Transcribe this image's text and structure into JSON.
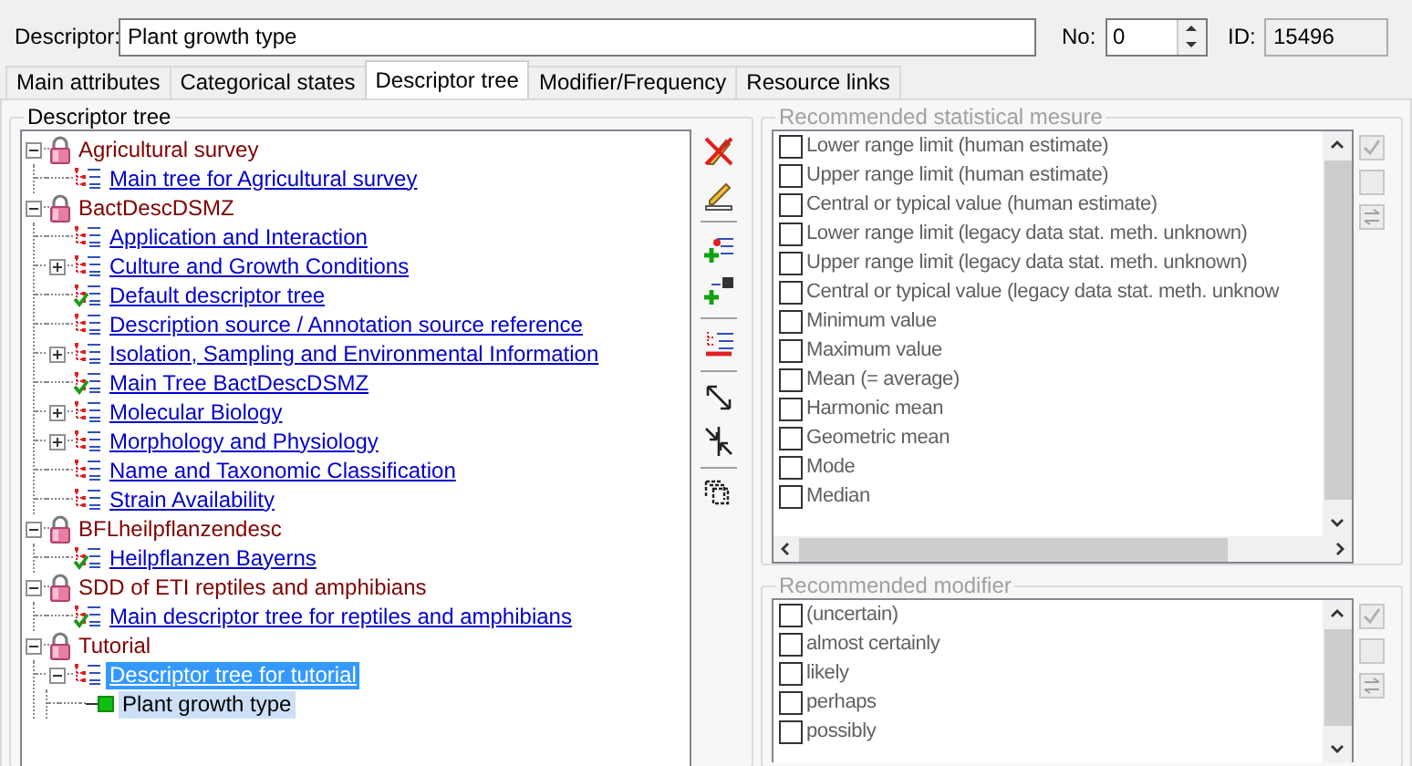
{
  "descriptor": {
    "label": "Descriptor:",
    "value": "Plant growth type"
  },
  "number": {
    "label": "No:",
    "value": "0"
  },
  "id": {
    "label": "ID:",
    "value": "15496",
    "disabled": true
  },
  "tabs": [
    {
      "label": "Main attributes",
      "selected": false
    },
    {
      "label": "Categorical states",
      "selected": false
    },
    {
      "label": "Descriptor tree",
      "selected": true
    },
    {
      "label": "Modifier/Frequency",
      "selected": false
    },
    {
      "label": "Resource links",
      "selected": false
    }
  ],
  "descriptor_tree": {
    "title": "Descriptor tree",
    "nodes": [
      {
        "label": "Agricultural survey",
        "kind": "project",
        "expanded": true,
        "selected": false,
        "children": [
          {
            "label": "Main tree for Agricultural survey",
            "kind": "tree",
            "default": false,
            "selected": false
          }
        ]
      },
      {
        "label": "BactDescDSMZ",
        "kind": "project",
        "expanded": true,
        "selected": false,
        "children": [
          {
            "label": "Application and Interaction",
            "kind": "tree",
            "default": false,
            "selected": false
          },
          {
            "label": "Culture and Growth Conditions",
            "kind": "tree",
            "default": false,
            "expanded": false,
            "selected": false
          },
          {
            "label": "Default descriptor tree",
            "kind": "tree",
            "default": true,
            "selected": false
          },
          {
            "label": "Description source / Annotation source reference",
            "kind": "tree",
            "default": false,
            "selected": false
          },
          {
            "label": "Isolation, Sampling and Environmental Information",
            "kind": "tree",
            "default": false,
            "expanded": false,
            "selected": false
          },
          {
            "label": "Main Tree BactDescDSMZ",
            "kind": "tree",
            "default": true,
            "selected": false
          },
          {
            "label": "Molecular Biology",
            "kind": "tree",
            "default": false,
            "expanded": false,
            "selected": false
          },
          {
            "label": "Morphology and Physiology",
            "kind": "tree",
            "default": false,
            "expanded": false,
            "selected": false
          },
          {
            "label": "Name and Taxonomic Classification",
            "kind": "tree",
            "default": false,
            "selected": false
          },
          {
            "label": "Strain Availability",
            "kind": "tree",
            "default": false,
            "selected": false
          }
        ]
      },
      {
        "label": "BFLheilpflanzendesc",
        "kind": "project",
        "expanded": true,
        "selected": false,
        "children": [
          {
            "label": "Heilpflanzen Bayerns",
            "kind": "tree",
            "default": true,
            "selected": false
          }
        ]
      },
      {
        "label": "SDD of ETI reptiles and amphibians",
        "kind": "project",
        "expanded": true,
        "selected": false,
        "children": [
          {
            "label": "Main descriptor tree for reptiles and amphibians",
            "kind": "tree",
            "default": true,
            "selected": false
          }
        ]
      },
      {
        "label": "Tutorial",
        "kind": "project",
        "expanded": true,
        "selected": false,
        "children": [
          {
            "label": "Descriptor tree for tutorial",
            "kind": "tree",
            "default": false,
            "expanded": true,
            "selected": true,
            "children": [
              {
                "label": "Plant growth type",
                "kind": "character",
                "selected": true
              }
            ]
          }
        ]
      }
    ]
  },
  "statistical_measure": {
    "title": "Recommended statistical mesure",
    "disabled": true,
    "items": [
      {
        "label": "Lower range limit (human estimate)",
        "checked": false
      },
      {
        "label": "Upper range limit (human estimate)",
        "checked": false
      },
      {
        "label": "Central or typical value (human estimate)",
        "checked": false
      },
      {
        "label": "Lower range limit (legacy data stat. meth. unknown)",
        "checked": false
      },
      {
        "label": "Upper range limit (legacy data stat. meth. unknown)",
        "checked": false
      },
      {
        "label": "Central or typical value (legacy data stat. meth. unknow",
        "checked": false
      },
      {
        "label": "Minimum value",
        "checked": false
      },
      {
        "label": "Maximum value",
        "checked": false
      },
      {
        "label": "Mean (= average)",
        "checked": false
      },
      {
        "label": "Harmonic mean",
        "checked": false
      },
      {
        "label": "Geometric mean",
        "checked": false
      },
      {
        "label": "Mode",
        "checked": false
      },
      {
        "label": "Median",
        "checked": false
      }
    ]
  },
  "modifier": {
    "title": "Recommended modifier",
    "disabled": true,
    "items": [
      {
        "label": "(uncertain)",
        "checked": false
      },
      {
        "label": "almost certainly",
        "checked": false
      },
      {
        "label": "likely",
        "checked": false
      },
      {
        "label": "perhaps",
        "checked": false
      },
      {
        "label": "possibly",
        "checked": false
      }
    ]
  }
}
